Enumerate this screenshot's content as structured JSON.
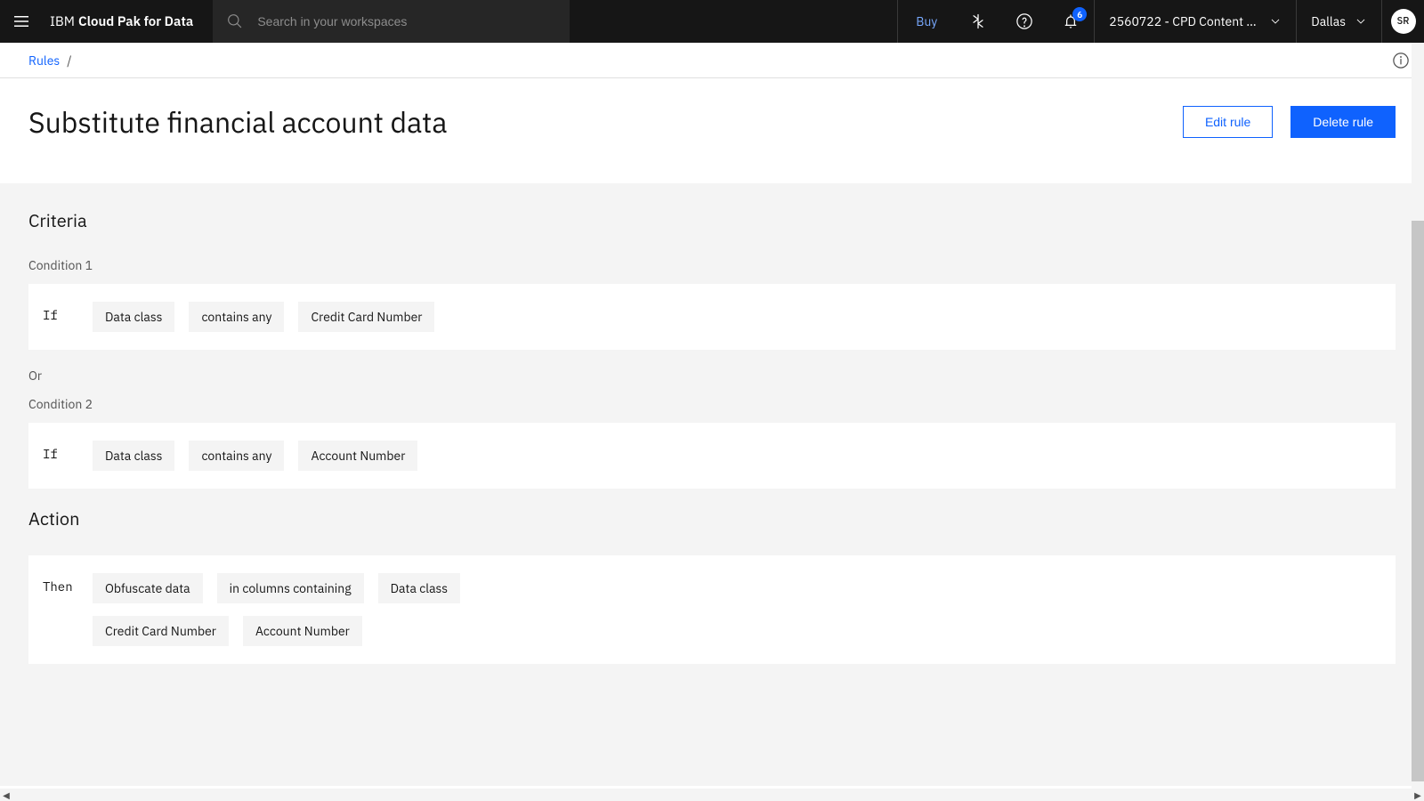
{
  "header": {
    "brand_light": "IBM",
    "brand_bold": "Cloud Pak for Data",
    "search_placeholder": "Search in your workspaces",
    "buy": "Buy",
    "notif_count": "6",
    "account": "2560722 - CPD Content D...",
    "region": "Dallas",
    "avatar_initials": "SR"
  },
  "breadcrumb": {
    "root": "Rules",
    "sep": "/"
  },
  "page": {
    "title": "Substitute financial account data",
    "edit": "Edit rule",
    "delete": "Delete rule"
  },
  "criteria": {
    "heading": "Criteria",
    "condition1_label": "Condition 1",
    "or_label": "Or",
    "condition2_label": "Condition 2",
    "if_label": "If",
    "cond1": {
      "a": "Data class",
      "b": "contains any",
      "c": "Credit Card Number"
    },
    "cond2": {
      "a": "Data class",
      "b": "contains any",
      "c": "Account Number"
    }
  },
  "action": {
    "heading": "Action",
    "then_label": "Then",
    "row1": {
      "a": "Obfuscate data",
      "b": "in columns containing",
      "c": "Data class"
    },
    "row2": {
      "a": "Credit Card Number",
      "b": "Account Number"
    }
  }
}
